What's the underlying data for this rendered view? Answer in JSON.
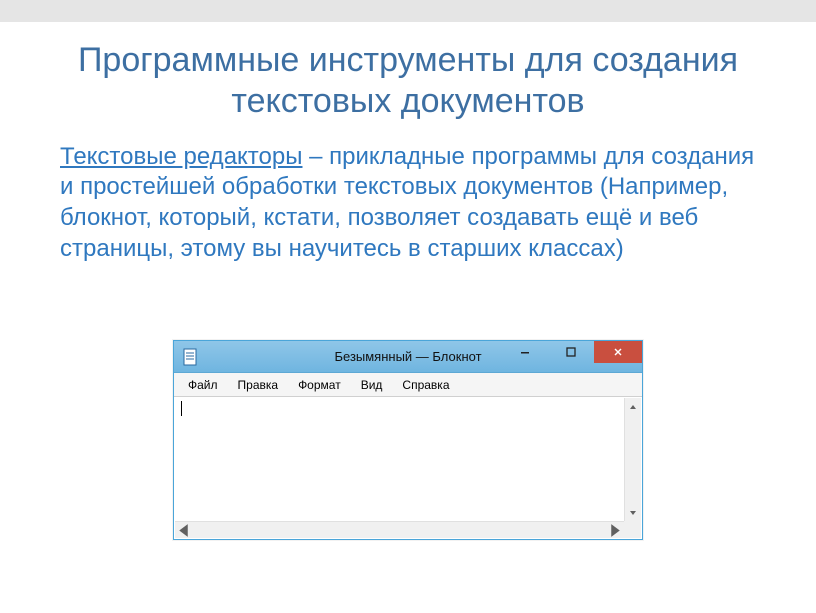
{
  "slide": {
    "title": "Программные инструменты для создания текстовых документов",
    "term": "Текстовые редакторы",
    "definition_rest": " – прикладные программы для создания и простейшей обработки текстовых документов (Например, блокнот, который, кстати, позволяет создавать ещё и веб страницы, этому вы научитесь в старших классах)"
  },
  "notepad": {
    "title": "Безымянный — Блокнот",
    "menu": {
      "file": "Файл",
      "edit": "Правка",
      "format": "Формат",
      "view": "Вид",
      "help": "Справка"
    },
    "text_content": ""
  }
}
